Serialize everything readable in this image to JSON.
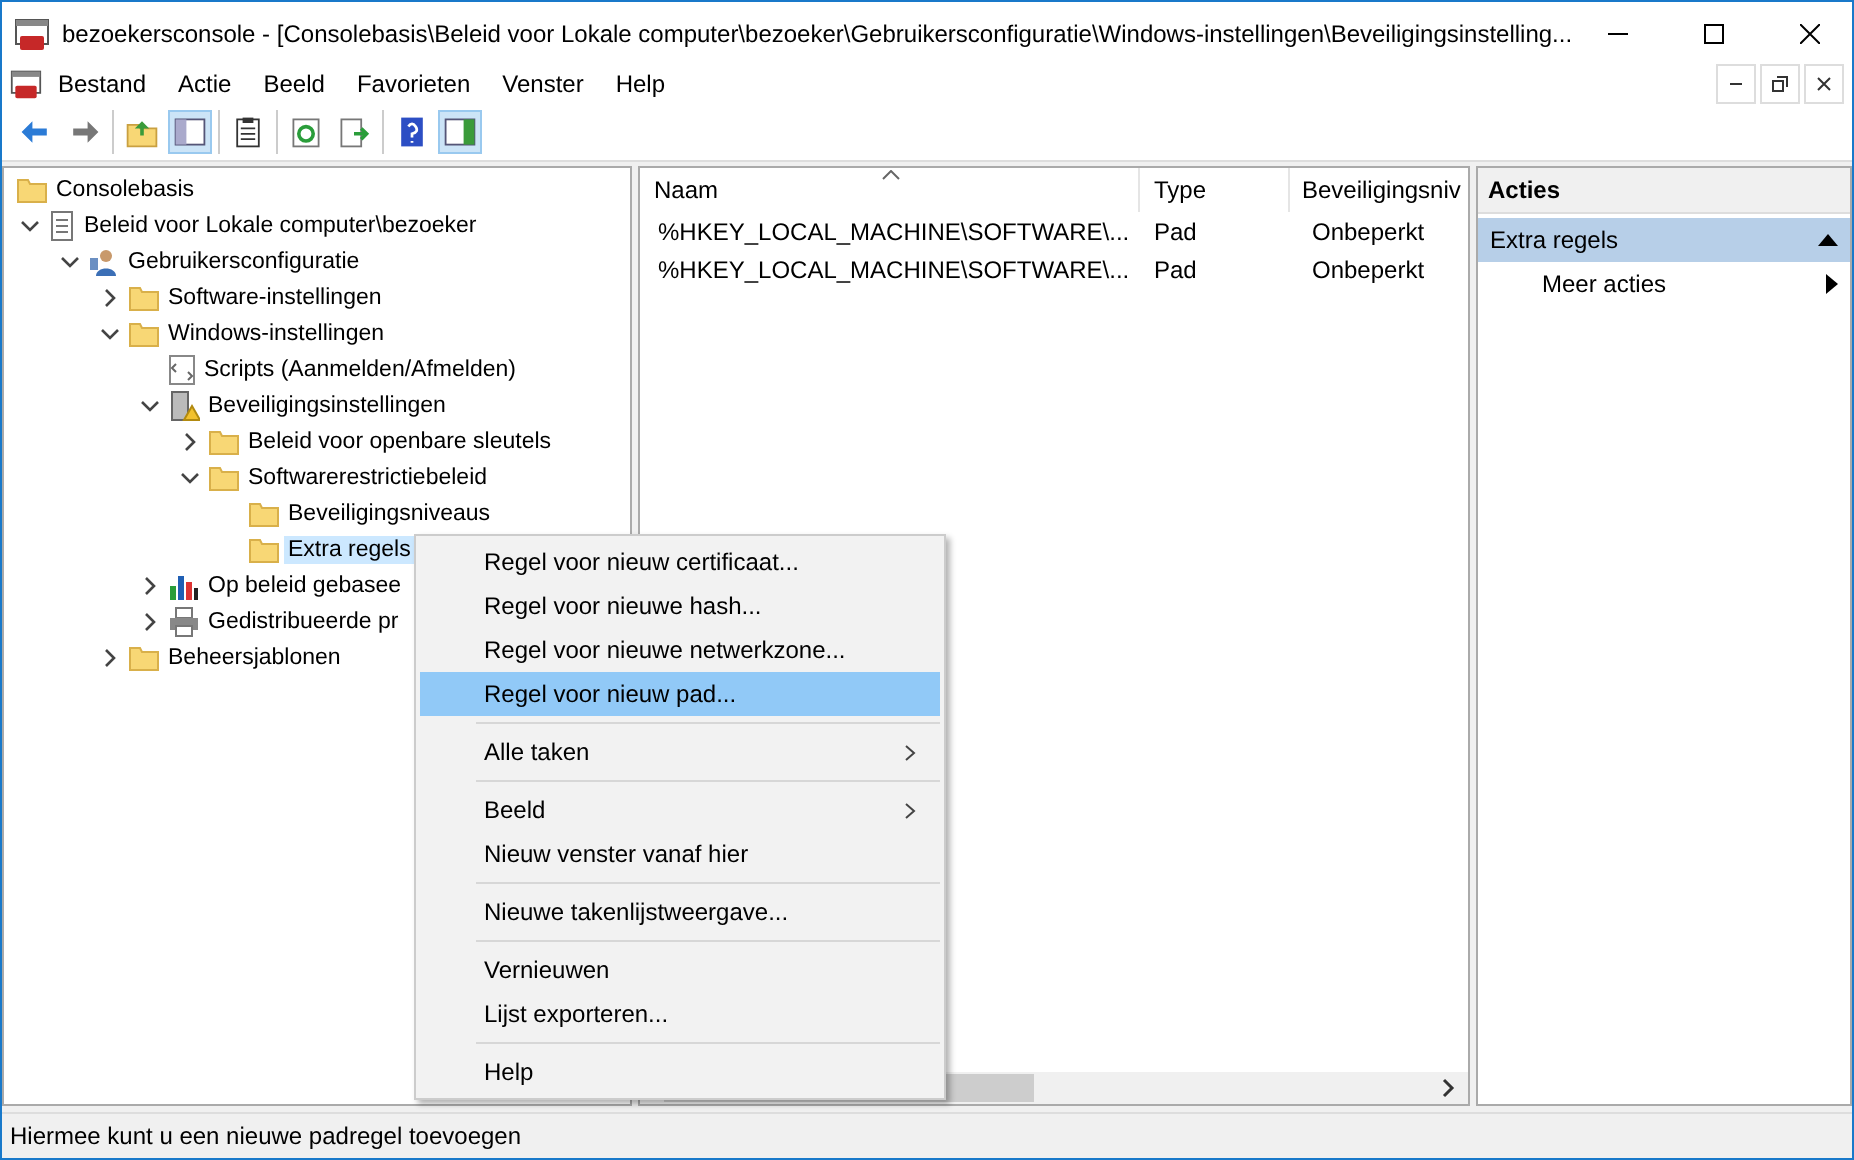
{
  "window": {
    "title": "bezoekersconsole - [Consolebasis\\Beleid voor Lokale computer\\bezoeker\\Gebruikersconfiguratie\\Windows-instellingen\\Beveiligingsinstelling..."
  },
  "menu": [
    "Bestand",
    "Actie",
    "Beeld",
    "Favorieten",
    "Venster",
    "Help"
  ],
  "toolbar": [
    [
      {
        "pressed": false
      },
      {
        "pressed": false
      }
    ],
    [
      {
        "pressed": false
      },
      {
        "pressed": true
      }
    ],
    [
      {
        "pressed": false
      }
    ],
    [
      {
        "pressed": false
      },
      {
        "pressed": false
      }
    ],
    [
      {
        "pressed": false
      },
      {
        "pressed": true
      }
    ]
  ],
  "tree": [
    {
      "label": "Consolebasis",
      "kind": "folder",
      "selected": false,
      "children": [
        {
          "label": "Beleid voor Lokale computer\\bezoeker",
          "kind": "policy",
          "selected": false,
          "expanded": true,
          "children": [
            {
              "label": "Gebruikersconfiguratie",
              "kind": "user",
              "selected": false,
              "expanded": true,
              "children": [
                {
                  "label": "Software-instellingen",
                  "kind": "folder",
                  "selected": false,
                  "expanded": false
                },
                {
                  "label": "Windows-instellingen",
                  "kind": "folder",
                  "selected": false,
                  "expanded": true,
                  "children": [
                    {
                      "label": "Scripts (Aanmelden/Afmelden)",
                      "kind": "script",
                      "selected": false
                    },
                    {
                      "label": "Beveiligingsinstellingen",
                      "kind": "security",
                      "selected": false,
                      "expanded": true,
                      "children": [
                        {
                          "label": "Beleid voor openbare sleutels",
                          "kind": "folder",
                          "selected": false,
                          "expanded": false
                        },
                        {
                          "label": "Softwarerestrictiebeleid",
                          "kind": "folder",
                          "selected": false,
                          "expanded": true,
                          "children": [
                            {
                              "label": "Beveiligingsniveaus",
                              "kind": "folder",
                              "selected": false
                            },
                            {
                              "label": "Extra regels",
                              "kind": "folder",
                              "selected": true
                            }
                          ]
                        }
                      ]
                    },
                    {
                      "label": "Op beleid gebasee",
                      "kind": "chart",
                      "selected": false,
                      "expanded": false
                    },
                    {
                      "label": "Gedistribueerde pr",
                      "kind": "printer",
                      "selected": false,
                      "expanded": false
                    }
                  ]
                },
                {
                  "label": "Beheersjablonen",
                  "kind": "folder",
                  "selected": false,
                  "expanded": false
                }
              ]
            }
          ]
        }
      ]
    }
  ],
  "list": {
    "columns": [
      "Naam",
      "Type",
      "Beveiligingsniv"
    ],
    "rows": [
      [
        "%HKEY_LOCAL_MACHINE\\SOFTWARE\\...",
        "Pad",
        "Onbeperkt"
      ],
      [
        "%HKEY_LOCAL_MACHINE\\SOFTWARE\\...",
        "Pad",
        "Onbeperkt"
      ]
    ]
  },
  "actions": {
    "title": "Acties",
    "section": "Extra regels",
    "items": [
      "Meer acties"
    ]
  },
  "context_menu": [
    [
      {
        "label": "Regel voor nieuw certificaat...",
        "selected": false,
        "submenu": false
      },
      {
        "label": "Regel voor nieuwe hash...",
        "selected": false,
        "submenu": false
      },
      {
        "label": "Regel voor nieuwe netwerkzone...",
        "selected": false,
        "submenu": false
      },
      {
        "label": "Regel voor nieuw pad...",
        "selected": true,
        "submenu": false
      }
    ],
    [
      {
        "label": "Alle taken",
        "selected": false,
        "submenu": true
      }
    ],
    [
      {
        "label": "Beeld",
        "selected": false,
        "submenu": true
      },
      {
        "label": "Nieuw venster vanaf hier",
        "selected": false,
        "submenu": false
      }
    ],
    [
      {
        "label": "Nieuwe takenlijstweergave...",
        "selected": false,
        "submenu": false
      }
    ],
    [
      {
        "label": "Vernieuwen",
        "selected": false,
        "submenu": false
      },
      {
        "label": "Lijst exporteren...",
        "selected": false,
        "submenu": false
      }
    ],
    [
      {
        "label": "Help",
        "selected": false,
        "submenu": false
      }
    ]
  ],
  "status_bar": "Hiermee kunt u een nieuwe padregel toevoegen"
}
